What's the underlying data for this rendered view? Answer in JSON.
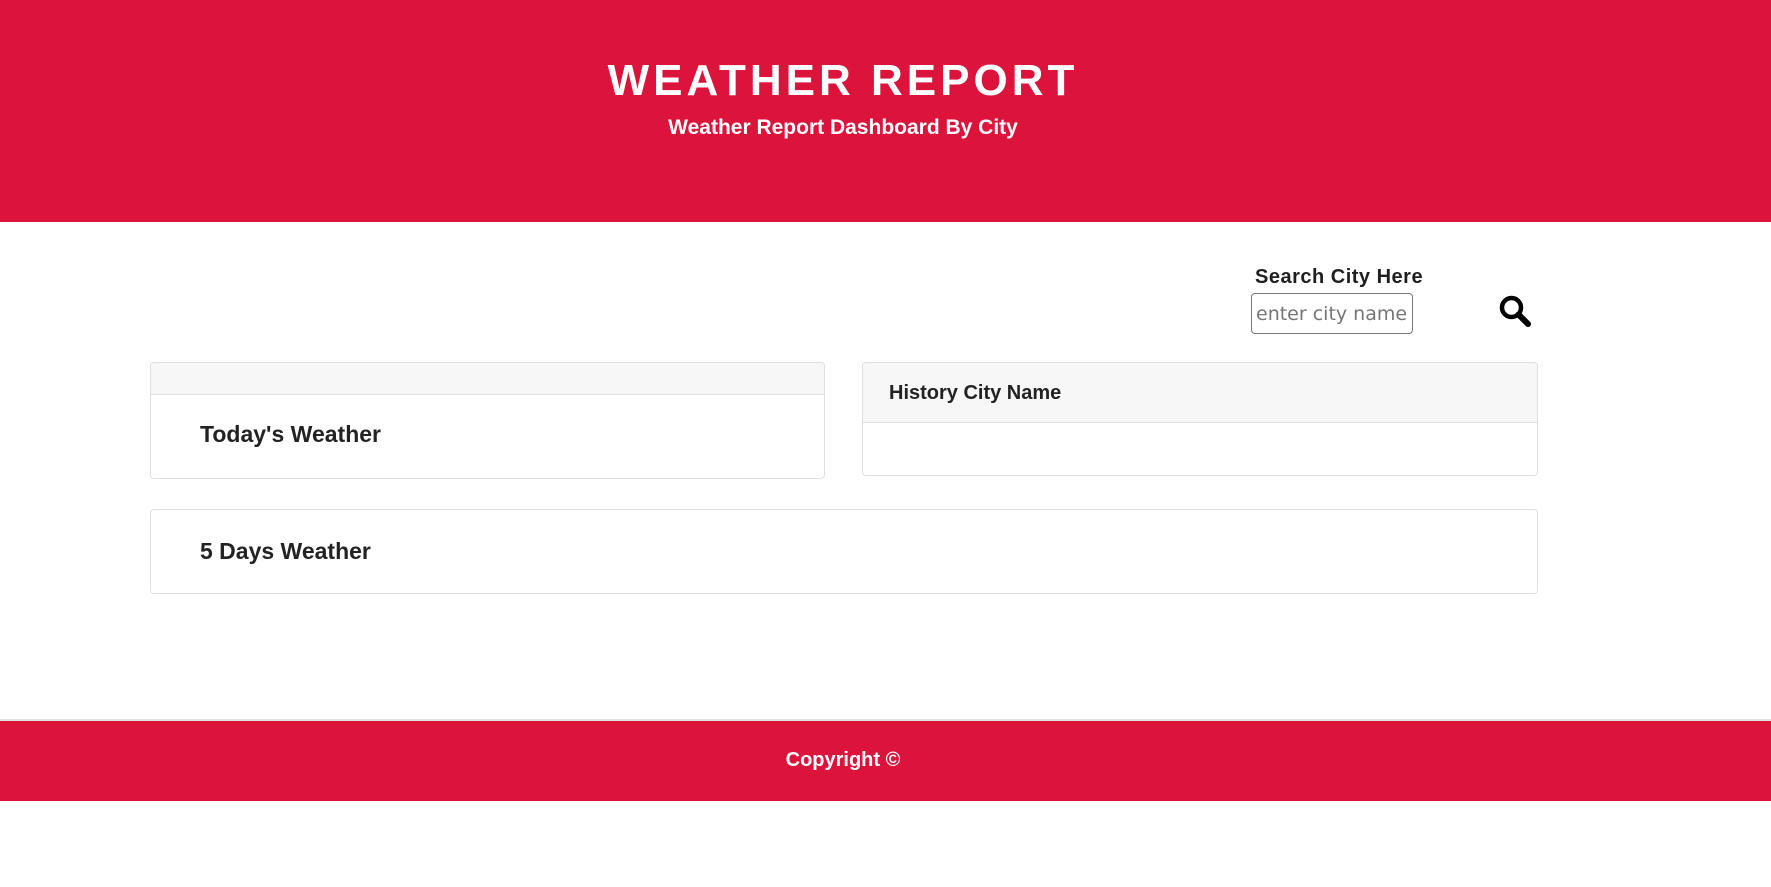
{
  "header": {
    "title": "WEATHER REPORT",
    "subtitle": "Weather Report Dashboard By City"
  },
  "search": {
    "label": "Search City Here",
    "placeholder": "enter city name",
    "value": "",
    "button_icon": "search-icon"
  },
  "today": {
    "title": "Today's Weather"
  },
  "history": {
    "title": "History City Name",
    "items": []
  },
  "forecast": {
    "title": "5 Days Weather"
  },
  "footer": {
    "text": "Copyright ©"
  },
  "colors": {
    "brand": "#dc143c",
    "card_header_bg": "#f7f7f7",
    "border": "#dfdfdf"
  }
}
